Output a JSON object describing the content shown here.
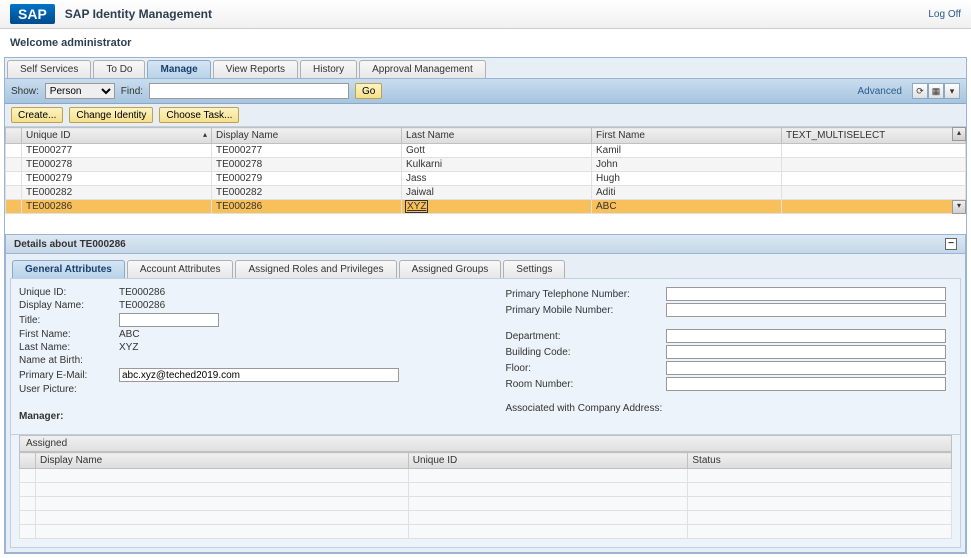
{
  "header": {
    "logo": "SAP",
    "title": "SAP Identity Management",
    "logoff": "Log Off"
  },
  "welcome": "Welcome administrator",
  "nav_tabs": [
    "Self Services",
    "To Do",
    "Manage",
    "View Reports",
    "History",
    "Approval Management"
  ],
  "nav_active": 2,
  "toolbar": {
    "show_label": "Show:",
    "show_value": "Person",
    "find_label": "Find:",
    "find_value": "",
    "go": "Go",
    "advanced": "Advanced"
  },
  "actions": {
    "create": "Create...",
    "change": "Change Identity",
    "choose": "Choose Task..."
  },
  "grid": {
    "headers": [
      "Unique ID",
      "Display Name",
      "Last Name",
      "First Name",
      "TEXT_MULTISELECT"
    ],
    "rows": [
      {
        "uid": "TE000277",
        "dn": "TE000277",
        "ln": "Gott",
        "fn": "Kamil",
        "tm": ""
      },
      {
        "uid": "TE000278",
        "dn": "TE000278",
        "ln": "Kulkarni",
        "fn": "John",
        "tm": ""
      },
      {
        "uid": "TE000279",
        "dn": "TE000279",
        "ln": "Jass",
        "fn": "Hugh",
        "tm": ""
      },
      {
        "uid": "TE000282",
        "dn": "TE000282",
        "ln": "Jaiwal",
        "fn": "Aditi",
        "tm": ""
      },
      {
        "uid": "TE000286",
        "dn": "TE000286",
        "ln": "XYZ",
        "fn": "ABC",
        "tm": ""
      }
    ],
    "selected": 4
  },
  "details": {
    "title": "Details about TE000286",
    "tabs": [
      "General Attributes",
      "Account Attributes",
      "Assigned Roles and Privileges",
      "Assigned Groups",
      "Settings"
    ],
    "tab_active": 0,
    "fields_left": {
      "unique_id": {
        "label": "Unique ID:",
        "value": "TE000286"
      },
      "display_name": {
        "label": "Display Name:",
        "value": "TE000286"
      },
      "title": {
        "label": "Title:",
        "value": ""
      },
      "first_name": {
        "label": "First Name:",
        "value": "ABC"
      },
      "last_name": {
        "label": "Last Name:",
        "value": "XYZ"
      },
      "name_birth": {
        "label": "Name at Birth:",
        "value": ""
      },
      "email": {
        "label": "Primary E-Mail:",
        "value": "abc.xyz@teched2019.com"
      },
      "picture": {
        "label": "User Picture:",
        "value": ""
      }
    },
    "fields_right": {
      "phone": {
        "label": "Primary Telephone Number:",
        "value": ""
      },
      "mobile": {
        "label": "Primary Mobile Number:",
        "value": ""
      },
      "dept": {
        "label": "Department:",
        "value": ""
      },
      "building": {
        "label": "Building Code:",
        "value": ""
      },
      "floor": {
        "label": "Floor:",
        "value": ""
      },
      "room": {
        "label": "Room Number:",
        "value": ""
      },
      "company_addr": {
        "label": "Associated with Company Address:",
        "value": ""
      }
    },
    "manager": {
      "label": "Manager:",
      "assigned": "Assigned",
      "headers": [
        "Display Name",
        "Unique ID",
        "Status"
      ]
    }
  }
}
